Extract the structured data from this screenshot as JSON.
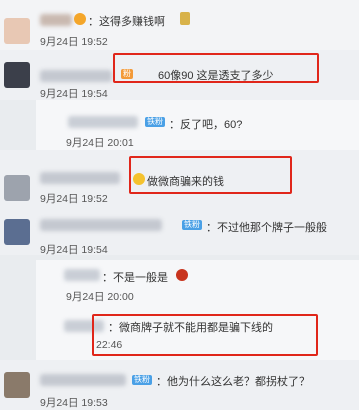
{
  "comments": [
    {
      "text": "：这得多赚钱啊",
      "date": "9月24日 19:52"
    },
    {
      "text": "60像90 这是透支了多少",
      "date": "9月24日 19:54"
    },
    {
      "badge": "铁粉",
      "text": "：反了吧，60?",
      "date": "9月24日 20:01"
    },
    {
      "text": "做微商骗来的钱",
      "date": "9月24日 19:52"
    },
    {
      "badge": "铁粉",
      "text": "：不过他那个牌子一般般",
      "date": "9月24日 19:54"
    },
    {
      "text": "：不是一般是",
      "date": "9月24日 20:00"
    },
    {
      "text": "：微商牌子就不能用都是骗下线的",
      "date": "22:46"
    },
    {
      "badge": "铁粉",
      "text": "：他为什么这么老？都拐杖了？",
      "date": "9月24日 19:53"
    }
  ],
  "badges": {
    "iron_fan": "铁粉"
  }
}
